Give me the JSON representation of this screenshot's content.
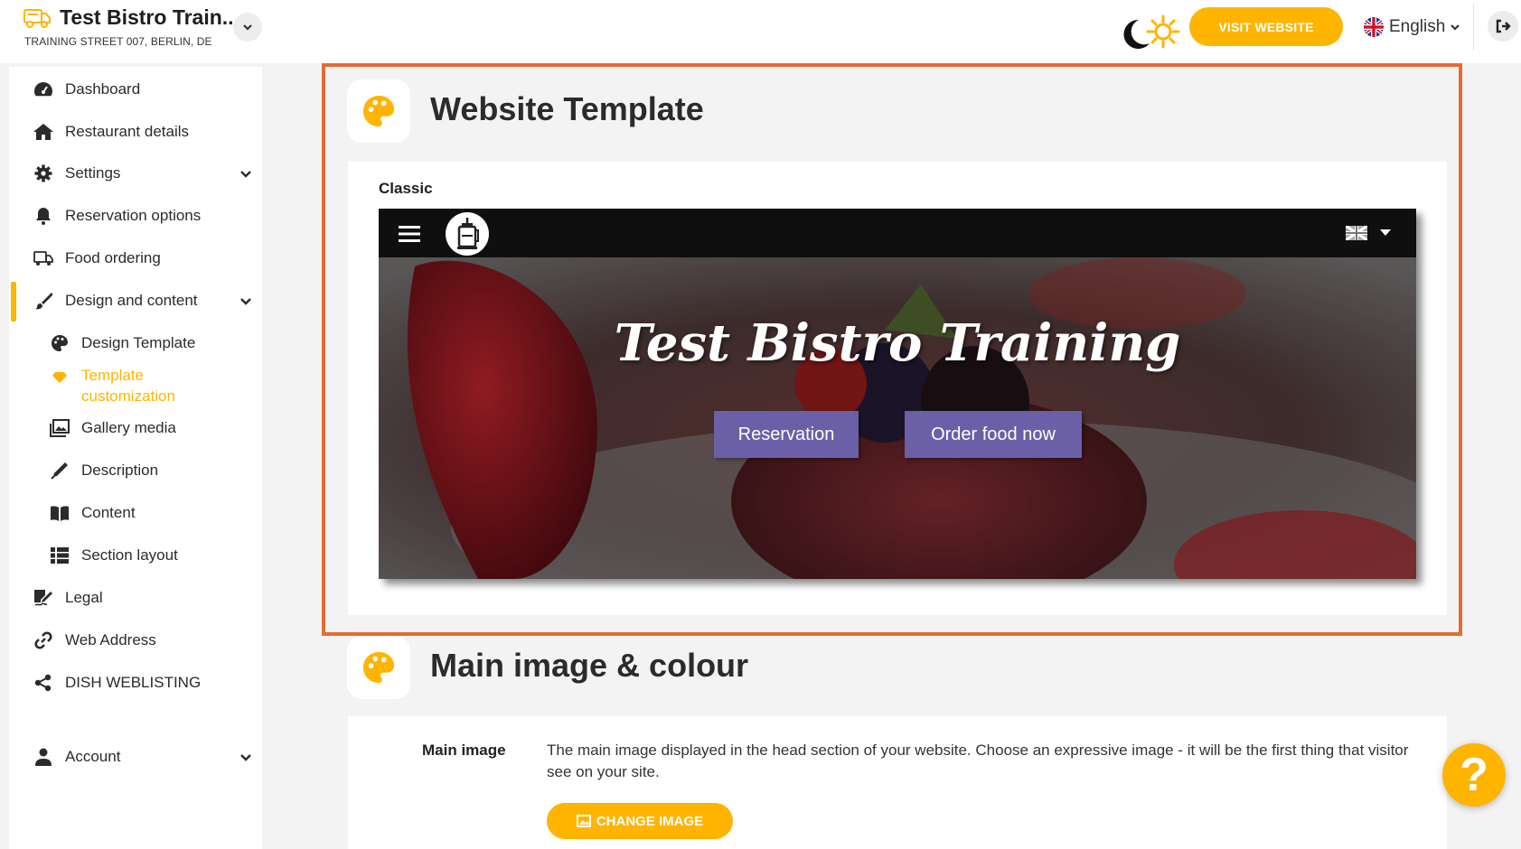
{
  "header": {
    "restaurant_name": "Test Bistro Train...",
    "address": "TRAINING STREET 007, BERLIN, DE",
    "visit_website_label": "VISIT WEBSITE",
    "language": "English"
  },
  "sidebar": {
    "items": [
      {
        "label": "Dashboard",
        "icon": "dashboard-icon"
      },
      {
        "label": "Restaurant details",
        "icon": "home-icon"
      },
      {
        "label": "Settings",
        "icon": "gear-icon"
      },
      {
        "label": "Reservation options",
        "icon": "bell-icon"
      },
      {
        "label": "Food ordering",
        "icon": "food-ordering-icon"
      },
      {
        "label": "Design and content",
        "icon": "brush-icon"
      },
      {
        "label": "Design Template",
        "icon": "palette-icon"
      },
      {
        "label": "Template customization",
        "icon": "gem-icon",
        "active": true
      },
      {
        "label": "Gallery media",
        "icon": "images-icon"
      },
      {
        "label": "Description",
        "icon": "pen-icon"
      },
      {
        "label": "Content",
        "icon": "book-icon"
      },
      {
        "label": "Section layout",
        "icon": "list-icon"
      },
      {
        "label": "Legal",
        "icon": "signature-icon"
      },
      {
        "label": "Web Address",
        "icon": "link-icon"
      },
      {
        "label": "DISH WEBLISTING",
        "icon": "share-icon"
      },
      {
        "label": "Account",
        "icon": "user-icon"
      }
    ]
  },
  "main": {
    "website_template": {
      "title": "Website Template",
      "template_name": "Classic",
      "preview": {
        "title": "Test Bistro Training",
        "reservation_label": "Reservation",
        "order_label": "Order food now"
      }
    },
    "main_image": {
      "title": "Main image & colour",
      "field_label": "Main image",
      "description": "The main image displayed in the head section of your website. Choose an expressive image - it will be the first thing that visitor see on your site.",
      "change_image_label": "CHANGE IMAGE"
    }
  },
  "help": {
    "label": "?"
  },
  "colors": {
    "accent": "#ffb400",
    "highlight_frame": "#e56b33",
    "preview_button": "#6b5fa8"
  }
}
